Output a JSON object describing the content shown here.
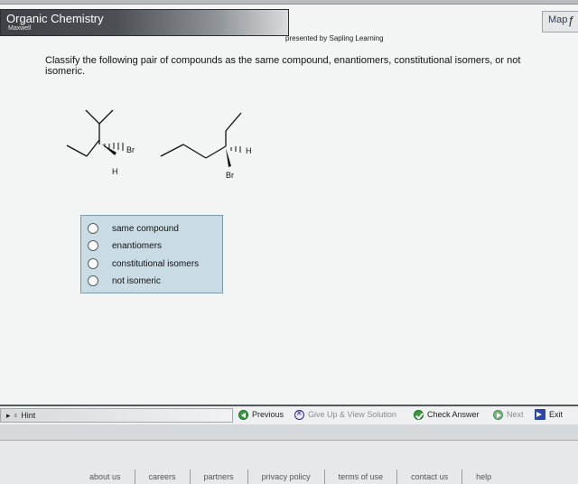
{
  "header": {
    "title": "Organic Chemistry",
    "subtitle": "Maxwell",
    "presented_by": "presented by Sapling Learning",
    "map_label": "Map"
  },
  "question": {
    "text": "Classify the following pair of compounds as the same compound, enantiomers, constitutional isomers, or not isomeric.",
    "molecule_left": {
      "wedge_label": "Br",
      "dash_label": "H"
    },
    "molecule_right": {
      "wedge_label": "H",
      "dash_label": "Br"
    }
  },
  "answers": [
    {
      "label": "same compound",
      "selected": false
    },
    {
      "label": "enantiomers",
      "selected": false
    },
    {
      "label": "constitutional isomers",
      "selected": false
    },
    {
      "label": "not isomeric",
      "selected": false
    }
  ],
  "toolbar": {
    "hint": "Hint",
    "previous": "Previous",
    "give_up": "Give Up & View Solution",
    "check_answer": "Check Answer",
    "next": "Next",
    "exit": "Exit"
  },
  "footer": {
    "links": [
      "about us",
      "careers",
      "partners",
      "privacy policy",
      "terms of use",
      "contact us",
      "help"
    ]
  },
  "colors": {
    "answer_panel": "#c9dce6",
    "header_dark": "#3e4146",
    "check_green": "#3a9a43",
    "exit_blue": "#2b46a8"
  }
}
